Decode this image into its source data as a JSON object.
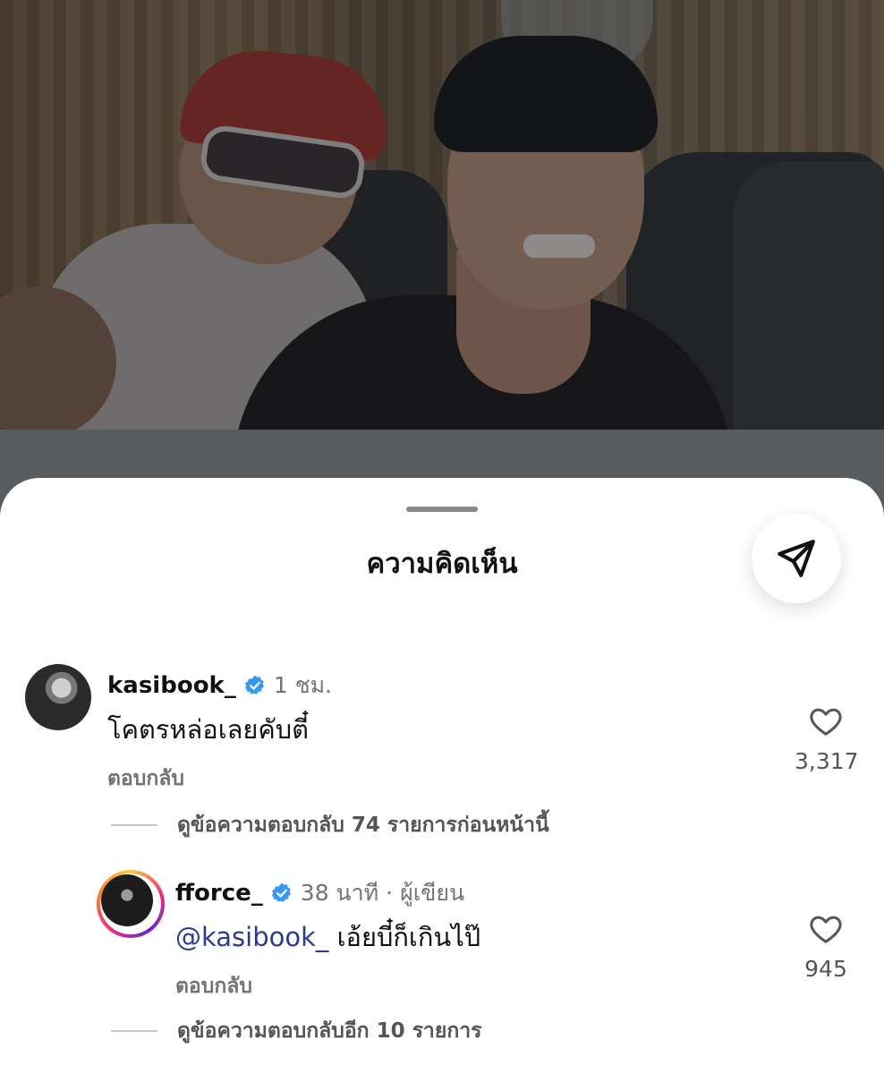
{
  "sheet": {
    "title": "ความคิดเห็น",
    "share_icon": "paper-plane-icon"
  },
  "comments": [
    {
      "username": "kasibook_",
      "verified": true,
      "time": "1 ชม.",
      "text": "โคตรหล่อเลยคับตี๋",
      "reply_label": "ตอบกลับ",
      "likes": "3,317",
      "view_replies": "ดูข้อความตอบกลับ 74 รายการก่อนหน้านี้"
    },
    {
      "username": "fforce_",
      "verified": true,
      "time": "38 นาที",
      "author_tag": "· ผู้เขียน",
      "mention": "@kasibook_",
      "text": "เอ้ยบี๋ก็เกินไป๊",
      "reply_label": "ตอบกลับ",
      "likes": "945",
      "view_replies": "ดูข้อความตอบกลับอีก 10 รายการ"
    }
  ],
  "colors": {
    "verified": "#3897f0",
    "mention": "#2c3c8c",
    "secondary_text": "#737373"
  }
}
